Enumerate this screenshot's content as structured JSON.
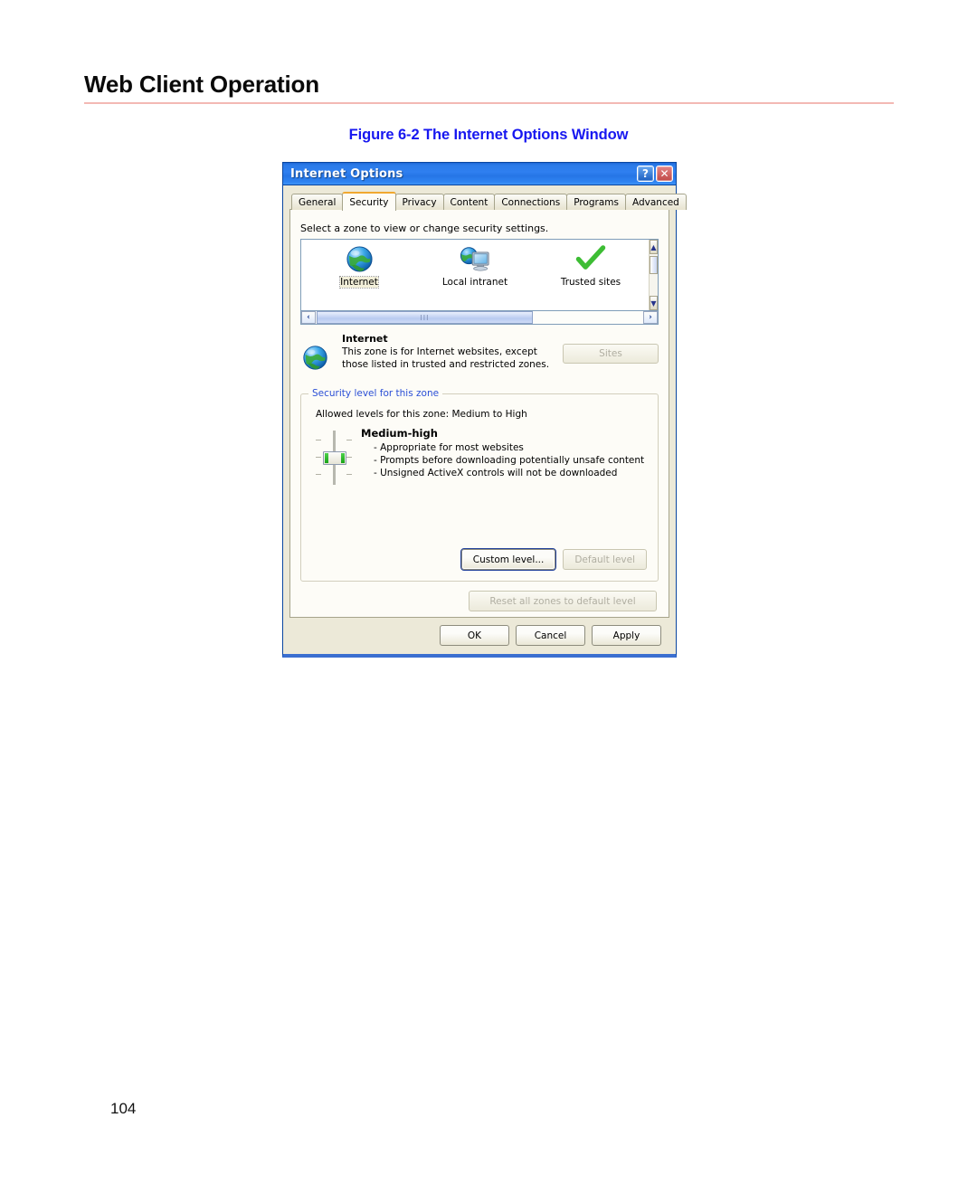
{
  "document": {
    "header_title": "Web Client Operation",
    "figure_caption": "Figure 6-2 The Internet Options Window",
    "page_number": "104",
    "rule_color": "#f3b9b4",
    "caption_color": "#1717f0"
  },
  "dialog": {
    "title": "Internet Options",
    "title_buttons": {
      "help": "?",
      "close": "✕"
    },
    "tabs": [
      {
        "label": "General",
        "active": false
      },
      {
        "label": "Security",
        "active": true
      },
      {
        "label": "Privacy",
        "active": false
      },
      {
        "label": "Content",
        "active": false
      },
      {
        "label": "Connections",
        "active": false
      },
      {
        "label": "Programs",
        "active": false
      },
      {
        "label": "Advanced",
        "active": false
      }
    ],
    "zone_prompt": "Select a zone to view or change security settings.",
    "zones": [
      {
        "label": "Internet",
        "icon": "globe-icon",
        "selected": true
      },
      {
        "label": "Local intranet",
        "icon": "globe-monitor-icon",
        "selected": false
      },
      {
        "label": "Trusted sites",
        "icon": "green-check-icon",
        "selected": false
      }
    ],
    "scrollbars": {
      "up_arrow": "▲",
      "down_arrow": "▼",
      "left_arrow": "‹",
      "right_arrow": "›",
      "thumb_grip": "III"
    },
    "zone_description": {
      "title": "Internet",
      "body": "This zone is for Internet websites, except those listed in trusted and restricted zones.",
      "sites_button": {
        "label": "Sites",
        "accel": "S",
        "enabled": false
      }
    },
    "security_group": {
      "legend": "Security level for this zone",
      "allowed_levels": "Allowed levels for this zone: Medium to High",
      "level_name": "Medium-high",
      "bullets": [
        "- Appropriate for most websites",
        "- Prompts before downloading potentially unsafe content",
        "- Unsigned ActiveX controls will not be downloaded"
      ],
      "custom_level_button": {
        "label": "Custom level...",
        "accel": "C",
        "enabled": true
      },
      "default_level_button": {
        "label": "Default level",
        "accel": "D",
        "enabled": false
      }
    },
    "reset_button": {
      "label": "Reset all zones to default level",
      "accel": "R",
      "enabled": false
    },
    "footer_buttons": [
      {
        "label": "OK",
        "enabled": true
      },
      {
        "label": "Cancel",
        "enabled": true
      },
      {
        "label": "Apply",
        "accel": "A",
        "enabled": true
      }
    ]
  }
}
